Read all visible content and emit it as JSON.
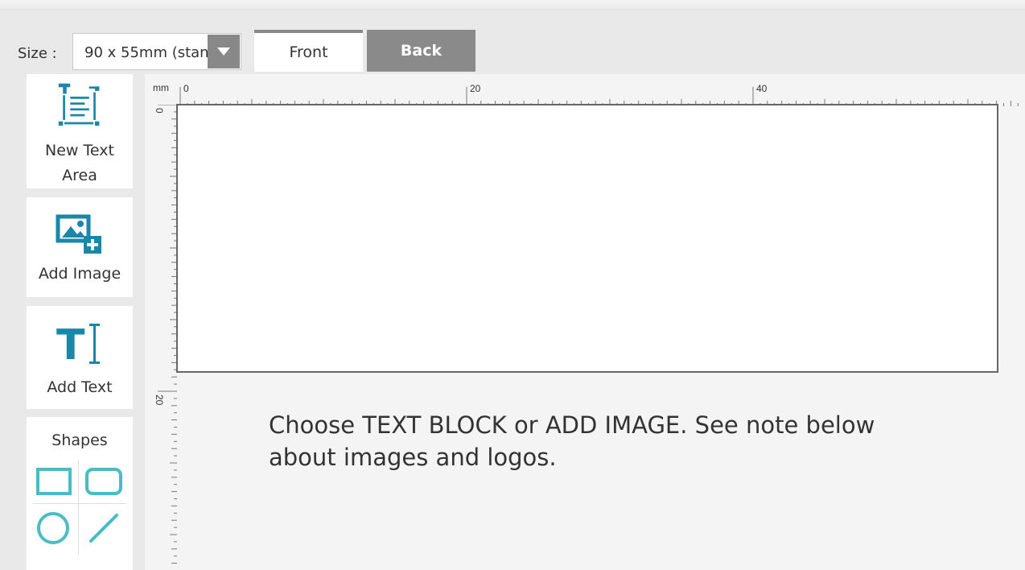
{
  "toolbar": {
    "size_label": "Size :",
    "size_value": "90 x 55mm (stan",
    "tabs": [
      {
        "label": "Front",
        "active": true
      },
      {
        "label": "Back",
        "active": false
      }
    ]
  },
  "tools": [
    {
      "label_lines": [
        "New Text",
        "Area"
      ],
      "icon": "text-area-icon"
    },
    {
      "label": "Add Image",
      "icon": "add-image-icon"
    },
    {
      "label": "Add Text",
      "icon": "text-cursor-icon"
    }
  ],
  "shapes": {
    "label": "Shapes",
    "items": [
      "rectangle-icon",
      "rounded-rectangle-icon",
      "circle-icon",
      "line-icon"
    ]
  },
  "ruler": {
    "unit": "mm",
    "h_labels": [
      "0",
      "20",
      "40"
    ],
    "v_labels": [
      "0",
      "20"
    ]
  },
  "canvas": {
    "instructions": "Choose TEXT BLOCK or ADD IMAGE. See note below about images and logos."
  },
  "colors": {
    "accent": "#1a86a8",
    "shape": "#4bbcc6",
    "tab_back": "#8a8a8a",
    "panel_bg": "#e9e9e9"
  }
}
